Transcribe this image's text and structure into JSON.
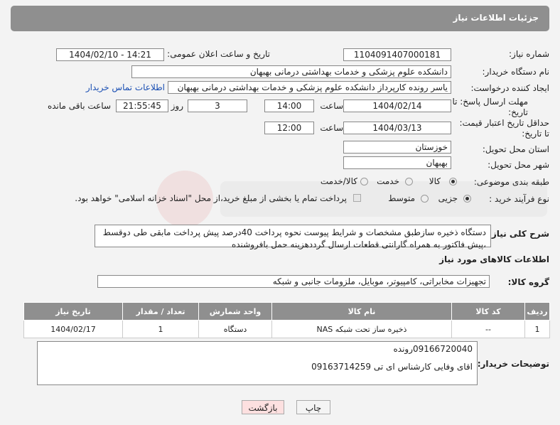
{
  "header": {
    "title": "جزئیات اطلاعات نیاز"
  },
  "form": {
    "need_number_label": "شماره نیاز:",
    "need_number": "1104091407000181",
    "announce_label": "تاریخ و ساعت اعلان عمومی:",
    "announce_value": "1404/02/10 - 14:21",
    "buyer_org_label": "نام دستگاه خریدار:",
    "buyer_org": "دانشکده علوم پزشکی و خدمات بهداشتی  درمانی بهبهان",
    "creator_label": "ایجاد کننده درخواست:",
    "creator": "یاسر رونده کارپرداز دانشکده علوم پزشکی و خدمات بهداشتی  درمانی بهبهان",
    "contact_link": "اطلاعات تماس خریدار",
    "deadline_label": "مهلت ارسال پاسخ: تا تاریخ:",
    "deadline_date": "1404/02/14",
    "time_label": "ساعت",
    "deadline_time": "14:00",
    "days_count": "3",
    "days_label": "روز و",
    "remaining_time": "21:55:45",
    "remaining_label": "ساعت باقی مانده",
    "price_validity_label": "حداقل تاریخ اعتبار قیمت: تا تاریخ:",
    "price_validity_date": "1404/03/13",
    "price_validity_time": "12:00",
    "province_label": "استان محل تحویل:",
    "province": "خوزستان",
    "city_label": "شهر محل تحویل:",
    "city": "بهبهان",
    "category_label": "طبقه بندی موضوعی:",
    "category_options": [
      "کالا",
      "خدمت",
      "کالا/خدمت"
    ],
    "category_selected": "کالا",
    "process_label": "نوع فرآیند خرید :",
    "process_options": [
      "جزیی",
      "متوسط"
    ],
    "process_selected": "جزیی",
    "payment_note": "پرداخت تمام یا بخشی از مبلغ خرید،از محل \"اسناد خزانه اسلامی\" خواهد بود."
  },
  "description": {
    "label": "شرح کلی نیاز:",
    "text": "دستگاه ذخیره سازطبق مشخصات و شرایط پیوست نحوه پرداخت 40درصد پیش پرداخت مابقی طی دوقسط ،پیش فاکتور به همراه گارانتی قطعات ارسال گرددهزینه حمل بافروشنده"
  },
  "goods": {
    "section_title": "اطلاعات کالاهای مورد نیاز",
    "group_label": "گروه کالا:",
    "group_value": "تجهیزات مخابراتی، کامپیوتر، موبایل، ملزومات جانبی و شبکه",
    "columns": [
      "ردیف",
      "کد کالا",
      "نام کالا",
      "واحد شمارش",
      "تعداد / مقدار",
      "تاریخ نیاز"
    ],
    "rows": [
      [
        "1",
        "--",
        "ذخیره ساز تحت شبکه NAS",
        "دستگاه",
        "1",
        "1404/02/17"
      ]
    ]
  },
  "buyer_notes": {
    "label": "توضیحات خریدار:",
    "line1": "09166720040رونده",
    "line2": "اقای وفایی کارشناس ای تی 09163714259"
  },
  "buttons": {
    "print": "چاپ",
    "back": "بازگشت"
  },
  "colors": {
    "header_bg": "#8f8f8f",
    "back_button_bg": "#fde0e0",
    "link": "#1a4fb3"
  }
}
